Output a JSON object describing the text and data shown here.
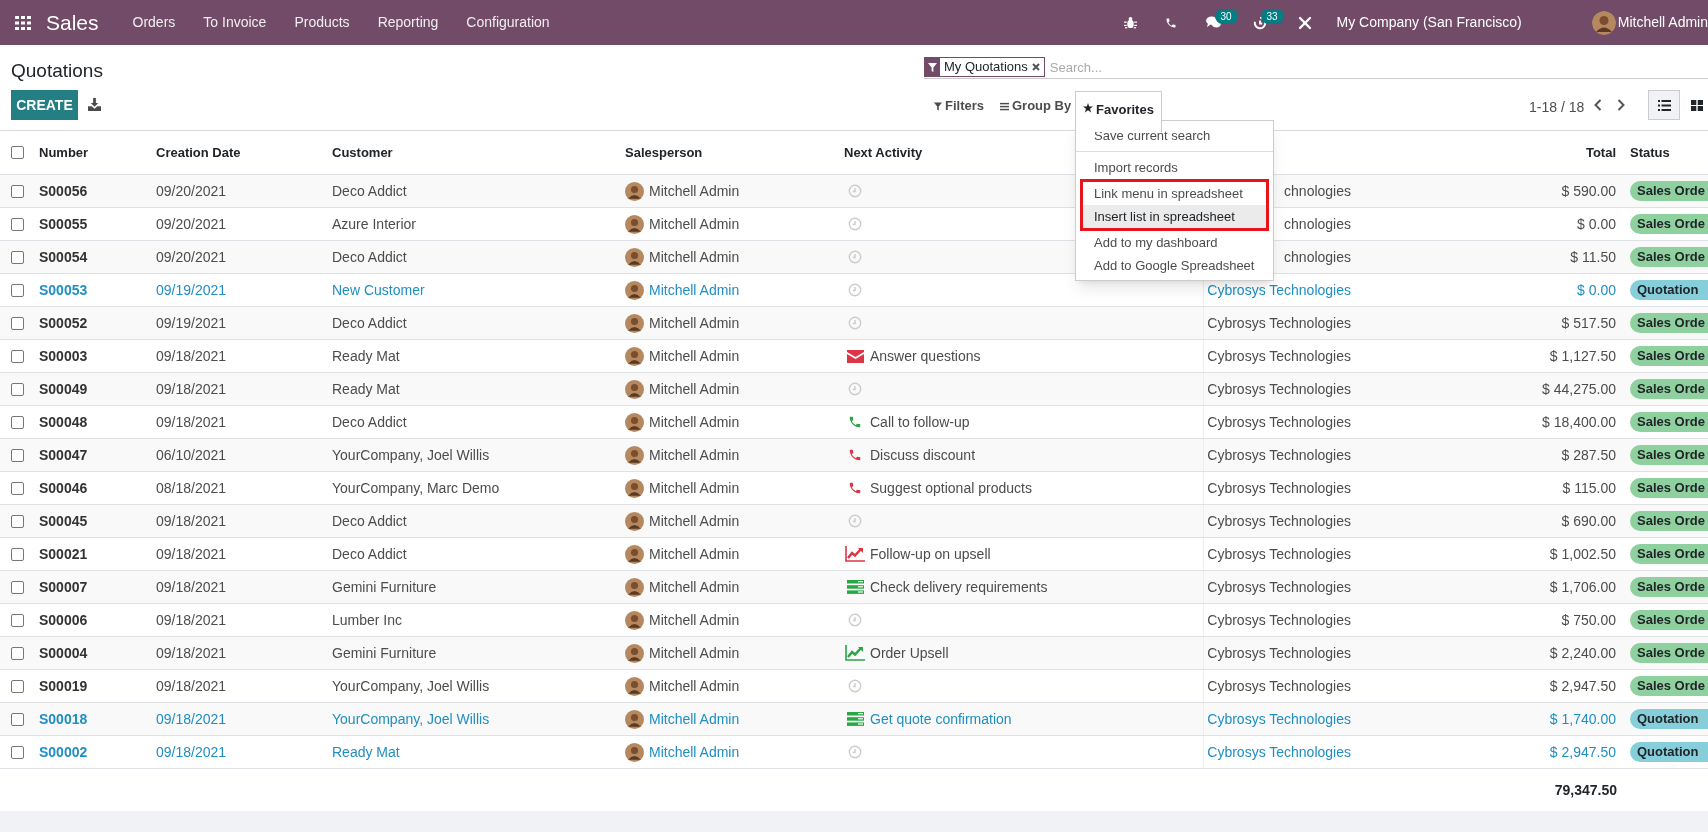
{
  "navbar": {
    "app": "Sales",
    "menus": [
      "Orders",
      "To Invoice",
      "Products",
      "Reporting",
      "Configuration"
    ],
    "messages_badge": "30",
    "activities_badge": "33",
    "company": "My Company (San Francisco)",
    "user": "Mitchell Admin"
  },
  "page": {
    "title": "Quotations",
    "create": "CREATE"
  },
  "search": {
    "facet": "My Quotations",
    "placeholder": "Search..."
  },
  "toolbar": {
    "filters": "Filters",
    "group_by": "Group By",
    "favorites": "Favorites",
    "favorites_open": true,
    "pager": "1-18 / 18"
  },
  "favorites_menu": [
    [
      {
        "label": "Save current search",
        "hovered": false,
        "highlighted": false
      }
    ],
    [
      {
        "label": "Import records",
        "hovered": false,
        "highlighted": false
      },
      {
        "label": "Link menu in spreadsheet",
        "hovered": false,
        "highlighted": true
      },
      {
        "label": "Insert list in spreadsheet",
        "hovered": true,
        "highlighted": true
      },
      {
        "label": "Add to my dashboard",
        "hovered": false,
        "highlighted": false
      },
      {
        "label": "Add to Google Spreadsheet",
        "hovered": false,
        "highlighted": false
      }
    ]
  ],
  "table": {
    "columns": [
      "Number",
      "Creation Date",
      "Customer",
      "Salesperson",
      "Next Activity",
      "Total",
      "Status"
    ],
    "select_all_checked": false,
    "rows": [
      {
        "number": "S00056",
        "date": "09/20/2021",
        "customer": "Deco Addict",
        "salesperson": "Mitchell Admin",
        "activity": {
          "kind": "none"
        },
        "company": "chnologies",
        "total": "$ 590.00",
        "status": "Sales Orde",
        "kind": "sales_order",
        "checked": false
      },
      {
        "number": "S00055",
        "date": "09/20/2021",
        "customer": "Azure Interior",
        "salesperson": "Mitchell Admin",
        "activity": {
          "kind": "none"
        },
        "company": "chnologies",
        "total": "$ 0.00",
        "status": "Sales Orde",
        "kind": "sales_order",
        "checked": false
      },
      {
        "number": "S00054",
        "date": "09/20/2021",
        "customer": "Deco Addict",
        "salesperson": "Mitchell Admin",
        "activity": {
          "kind": "none"
        },
        "company": "chnologies",
        "total": "$ 11.50",
        "status": "Sales Orde",
        "kind": "sales_order",
        "checked": false
      },
      {
        "number": "S00053",
        "date": "09/19/2021",
        "customer": "New Customer",
        "salesperson": "Mitchell Admin",
        "activity": {
          "kind": "none"
        },
        "company": "Cybrosys Technologies",
        "total": "$ 0.00",
        "status": "Quotation",
        "kind": "quotation",
        "checked": false
      },
      {
        "number": "S00052",
        "date": "09/19/2021",
        "customer": "Deco Addict",
        "salesperson": "Mitchell Admin",
        "activity": {
          "kind": "none"
        },
        "company": "Cybrosys Technologies",
        "total": "$ 517.50",
        "status": "Sales Orde",
        "kind": "sales_order",
        "checked": false
      },
      {
        "number": "S00003",
        "date": "09/18/2021",
        "customer": "Ready Mat",
        "salesperson": "Mitchell Admin",
        "activity": {
          "kind": "email",
          "color": "#dc3545",
          "label": "Answer questions"
        },
        "company": "Cybrosys Technologies",
        "total": "$ 1,127.50",
        "status": "Sales Orde",
        "kind": "sales_order",
        "checked": false
      },
      {
        "number": "S00049",
        "date": "09/18/2021",
        "customer": "Ready Mat",
        "salesperson": "Mitchell Admin",
        "activity": {
          "kind": "none"
        },
        "company": "Cybrosys Technologies",
        "total": "$ 44,275.00",
        "status": "Sales Orde",
        "kind": "sales_order",
        "checked": false
      },
      {
        "number": "S00048",
        "date": "09/18/2021",
        "customer": "Deco Addict",
        "salesperson": "Mitchell Admin",
        "activity": {
          "kind": "phone",
          "color": "#28a745",
          "label": "Call to follow-up"
        },
        "company": "Cybrosys Technologies",
        "total": "$ 18,400.00",
        "status": "Sales Orde",
        "kind": "sales_order",
        "checked": false
      },
      {
        "number": "S00047",
        "date": "06/10/2021",
        "customer": "YourCompany, Joel Willis",
        "salesperson": "Mitchell Admin",
        "activity": {
          "kind": "phone",
          "color": "#dc3545",
          "label": "Discuss discount"
        },
        "company": "Cybrosys Technologies",
        "total": "$ 287.50",
        "status": "Sales Orde",
        "kind": "sales_order",
        "checked": false
      },
      {
        "number": "S00046",
        "date": "08/18/2021",
        "customer": "YourCompany, Marc Demo",
        "salesperson": "Mitchell Admin",
        "activity": {
          "kind": "phone",
          "color": "#dc3545",
          "label": "Suggest optional products"
        },
        "company": "Cybrosys Technologies",
        "total": "$ 115.00",
        "status": "Sales Orde",
        "kind": "sales_order",
        "checked": false
      },
      {
        "number": "S00045",
        "date": "09/18/2021",
        "customer": "Deco Addict",
        "salesperson": "Mitchell Admin",
        "activity": {
          "kind": "none"
        },
        "company": "Cybrosys Technologies",
        "total": "$ 690.00",
        "status": "Sales Orde",
        "kind": "sales_order",
        "checked": false
      },
      {
        "number": "S00021",
        "date": "09/18/2021",
        "customer": "Deco Addict",
        "salesperson": "Mitchell Admin",
        "activity": {
          "kind": "upsell",
          "color": "#dc3545",
          "label": "Follow-up on upsell"
        },
        "company": "Cybrosys Technologies",
        "total": "$ 1,002.50",
        "status": "Sales Orde",
        "kind": "sales_order",
        "checked": false
      },
      {
        "number": "S00007",
        "date": "09/18/2021",
        "customer": "Gemini Furniture",
        "salesperson": "Mitchell Admin",
        "activity": {
          "kind": "todo",
          "color": "#28a745",
          "label": "Check delivery requirements"
        },
        "company": "Cybrosys Technologies",
        "total": "$ 1,706.00",
        "status": "Sales Orde",
        "kind": "sales_order",
        "checked": false
      },
      {
        "number": "S00006",
        "date": "09/18/2021",
        "customer": "Lumber Inc",
        "salesperson": "Mitchell Admin",
        "activity": {
          "kind": "none"
        },
        "company": "Cybrosys Technologies",
        "total": "$ 750.00",
        "status": "Sales Orde",
        "kind": "sales_order",
        "checked": false
      },
      {
        "number": "S00004",
        "date": "09/18/2021",
        "customer": "Gemini Furniture",
        "salesperson": "Mitchell Admin",
        "activity": {
          "kind": "upsell",
          "color": "#28a745",
          "label": "Order Upsell"
        },
        "company": "Cybrosys Technologies",
        "total": "$ 2,240.00",
        "status": "Sales Orde",
        "kind": "sales_order",
        "checked": false
      },
      {
        "number": "S00019",
        "date": "09/18/2021",
        "customer": "YourCompany, Joel Willis",
        "salesperson": "Mitchell Admin",
        "activity": {
          "kind": "none"
        },
        "company": "Cybrosys Technologies",
        "total": "$ 2,947.50",
        "status": "Sales Orde",
        "kind": "sales_order",
        "checked": false
      },
      {
        "number": "S00018",
        "date": "09/18/2021",
        "customer": "YourCompany, Joel Willis",
        "salesperson": "Mitchell Admin",
        "activity": {
          "kind": "todo",
          "color": "#28a745",
          "label": "Get quote confirmation"
        },
        "company": "Cybrosys Technologies",
        "total": "$ 1,740.00",
        "status": "Quotation",
        "kind": "quotation",
        "checked": false
      },
      {
        "number": "S00002",
        "date": "09/18/2021",
        "customer": "Ready Mat",
        "salesperson": "Mitchell Admin",
        "activity": {
          "kind": "none"
        },
        "company": "Cybrosys Technologies",
        "total": "$ 2,947.50",
        "status": "Quotation",
        "kind": "quotation",
        "checked": false
      }
    ],
    "sum": "79,347.50"
  }
}
